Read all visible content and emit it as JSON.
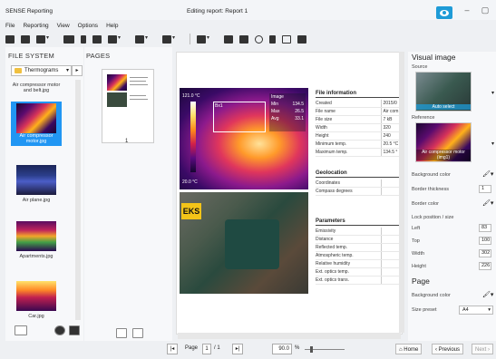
{
  "window": {
    "app_title": "SENSE Reporting",
    "doc_title": "Editing report: Report 1"
  },
  "menu": [
    "File",
    "Reporting",
    "View",
    "Options",
    "Help"
  ],
  "filesystem": {
    "title": "FILE SYSTEM",
    "folder": "Thermograms",
    "items": [
      "Air compressor motor and belt.jpg",
      "Air compressor motor.jpg",
      "Air plane.jpg",
      "Apartments.jpg",
      "Car.jpg"
    ]
  },
  "pages": {
    "title": "PAGES",
    "page_number": "1"
  },
  "report": {
    "image_title": "Image",
    "min_label": "Min",
    "min_value": "134.5",
    "max_label": "Max",
    "max_value": "26.5",
    "avg_label": "Avg",
    "avg_value": "33.1",
    "scale_top": "121.0 °C",
    "scale_bottom": "20.0 °C",
    "bx_label": "Bx1",
    "photo_text": "EKS",
    "file_info": {
      "header": "File information",
      "rows": [
        {
          "k": "Created",
          "v": "2015/0"
        },
        {
          "k": "File name",
          "v": "Air com"
        },
        {
          "k": "File size",
          "v": "7 kB"
        },
        {
          "k": "Width",
          "v": "320"
        },
        {
          "k": "Height",
          "v": "240"
        },
        {
          "k": "Minimum temp.",
          "v": "20.5 °C"
        },
        {
          "k": "Maximum temp.",
          "v": "134.5 °"
        }
      ]
    },
    "geolocation": {
      "header": "Geolocation",
      "rows": [
        {
          "k": "Coordinates",
          "v": ""
        },
        {
          "k": "Compass degrees",
          "v": ""
        }
      ]
    },
    "parameters": {
      "header": "Parameters",
      "rows": [
        {
          "k": "Emissivity",
          "v": ""
        },
        {
          "k": "Distance",
          "v": ""
        },
        {
          "k": "Reflected temp.",
          "v": ""
        },
        {
          "k": "Atmospheric temp.",
          "v": ""
        },
        {
          "k": "Relative humidity",
          "v": ""
        },
        {
          "k": "Ext. optics temp.",
          "v": ""
        },
        {
          "k": "Ext. optics trans.",
          "v": ""
        }
      ]
    }
  },
  "status": {
    "page_label": "Page",
    "page_current": "1",
    "page_total": "/ 1",
    "zoom": "90.0",
    "zoom_unit": "%"
  },
  "nav": {
    "home": "Home",
    "previous": "Previous",
    "next": "Next"
  },
  "right_panel": {
    "title": "Visual image",
    "source_label": "Source",
    "source_caption": "Auto select",
    "reference_label": "Reference",
    "reference_caption": "Air compressor motor (img1)",
    "bg_color_label": "Background color",
    "border_thickness_label": "Border thickness",
    "border_thickness_value": "1",
    "border_color_label": "Border color",
    "lock_label": "Lock position / size",
    "left_label": "Left",
    "left_value": "83",
    "top_label": "Top",
    "top_value": "100",
    "width_label": "Width",
    "width_value": "302",
    "height_label": "Height",
    "height_value": "226",
    "page_title": "Page",
    "page_bg_label": "Background color",
    "size_label": "Size preset",
    "size_value": "A4"
  },
  "colors": {
    "accent": "#1e9bd7",
    "selection": "#2196f3"
  }
}
